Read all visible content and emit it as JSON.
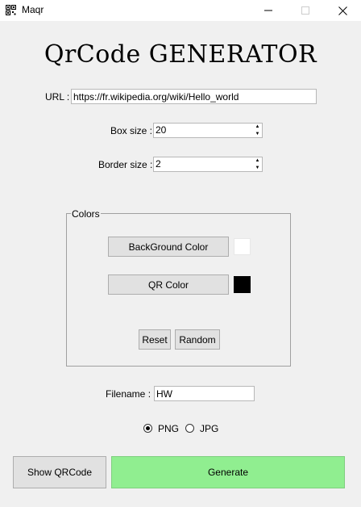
{
  "window": {
    "title": "Maqr",
    "icon": "qr-app-icon",
    "controls": [
      "minimize",
      "maximize",
      "close"
    ]
  },
  "heading": "QrCode GENERATOR",
  "url": {
    "label": "URL :",
    "value": "https://fr.wikipedia.org/wiki/Hello_world"
  },
  "box_size": {
    "label": "Box size :",
    "value": "20"
  },
  "border_size": {
    "label": "Border size :",
    "value": "2"
  },
  "colors": {
    "legend": "Colors",
    "background_button": "BackGround Color",
    "background_color": "#ffffff",
    "qr_button": "QR Color",
    "qr_color": "#000000",
    "reset": "Reset",
    "random": "Random"
  },
  "filename": {
    "label": "Filename :",
    "value": "HW"
  },
  "format": {
    "options": [
      "PNG",
      "JPG"
    ],
    "selected": "PNG"
  },
  "actions": {
    "show": "Show QRCode",
    "generate": "Generate",
    "generate_color": "#90ee90"
  }
}
